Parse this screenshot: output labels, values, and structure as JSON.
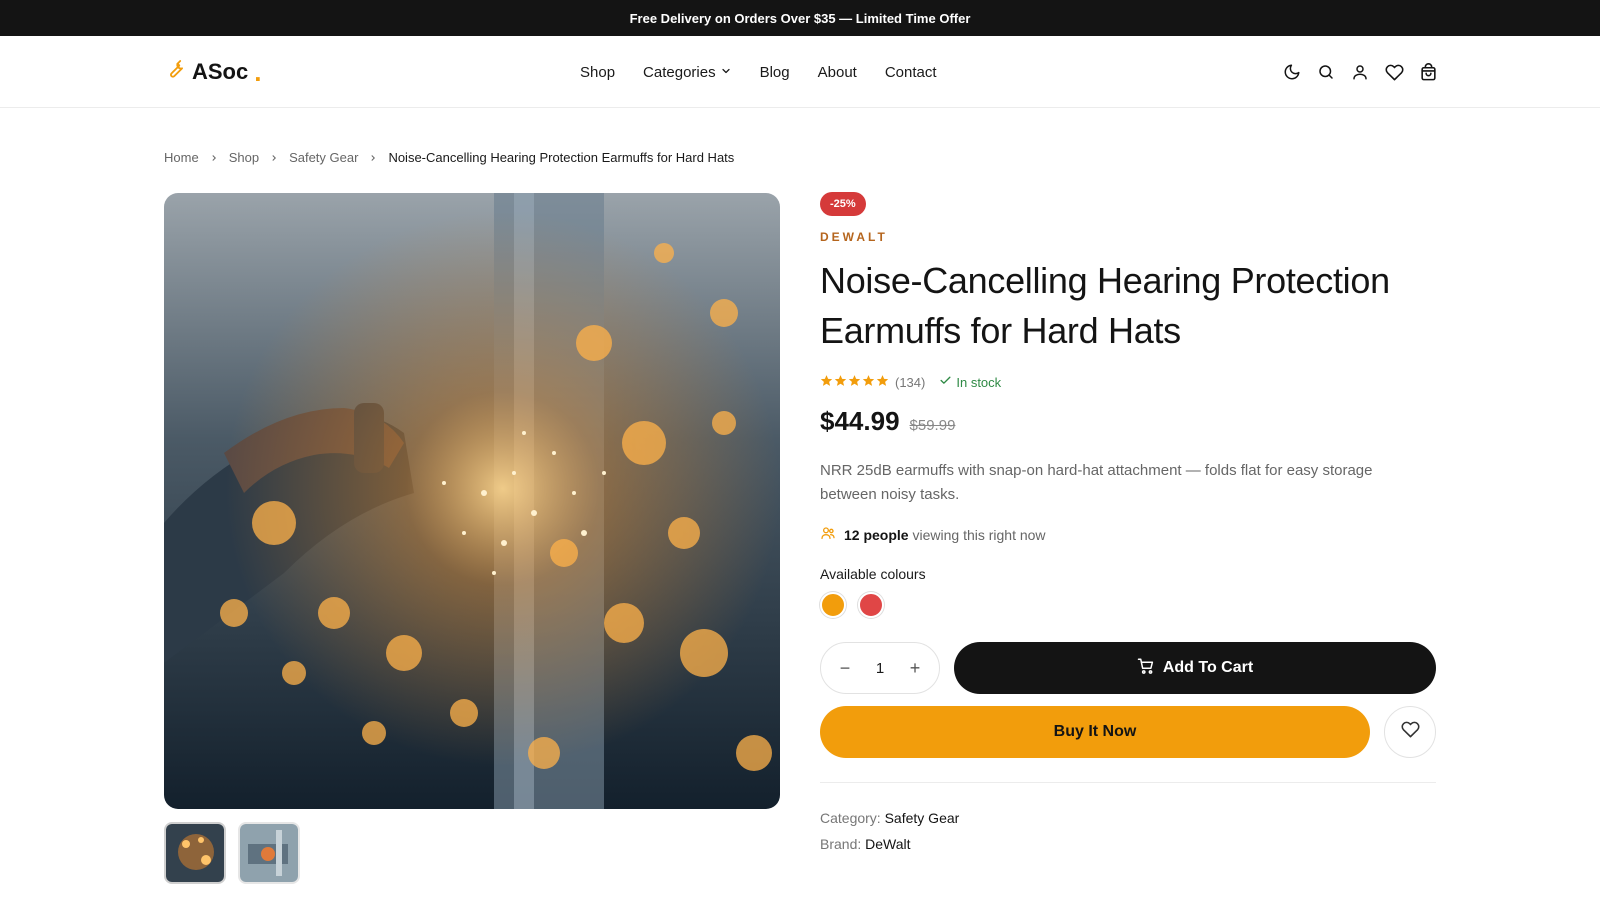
{
  "announcement": "Free Delivery on Orders Over $35 — Limited Time Offer",
  "header": {
    "logo_text": "ASoc",
    "logo_dot": ".",
    "nav": [
      "Shop",
      "Categories",
      "Blog",
      "About",
      "Contact"
    ],
    "icons": [
      "moon-icon",
      "search-icon",
      "user-icon",
      "heart-icon",
      "bag-icon"
    ]
  },
  "breadcrumb": [
    "Home",
    "Shop",
    "Safety Gear",
    "Noise-Cancelling Hearing Protection Earmuffs for Hard Hats"
  ],
  "product": {
    "badge": "-25%",
    "brand": "DEWALT",
    "title": "Noise-Cancelling Hearing Protection Earmuffs for Hard Hats",
    "rating": 5,
    "review_count": "(134)",
    "stock": "In stock",
    "price": "$44.99",
    "old_price": "$59.99",
    "description": "NRR 25dB earmuffs with snap-on hard-hat attachment — folds flat for easy storage between noisy tasks.",
    "viewers_bold": "12 people",
    "viewers_text": "viewing this right now",
    "colours_label": "Available colours",
    "colours": [
      "#f29d0c",
      "#e04646"
    ],
    "quantity": "1",
    "add_to_cart": "Add To Cart",
    "buy_now": "Buy It Now",
    "meta": {
      "category_label": "Category:",
      "category_value": "Safety Gear",
      "brand_label": "Brand:",
      "brand_value": "DeWalt"
    }
  },
  "colors": {
    "accent": "#f29d0c",
    "dark": "#141414",
    "sale": "#d53a3a",
    "stock": "#2f8a45"
  }
}
